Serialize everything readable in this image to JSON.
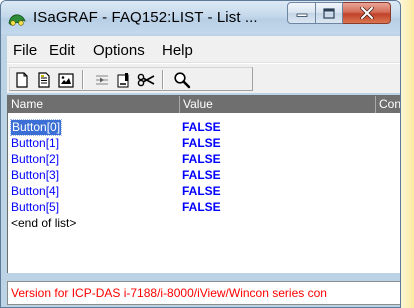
{
  "window": {
    "title": "ISaGRAF - FAQ152:LIST - List ..."
  },
  "menu": {
    "file": "File",
    "edit": "Edit",
    "options": "Options",
    "help": "Help"
  },
  "toolbar": {
    "icons": [
      "new-list-icon",
      "open-list-icon",
      "save-list-icon",
      "insert-variable-icon",
      "edit-variable-icon",
      "cut-icon",
      "search-icon"
    ]
  },
  "list": {
    "columns": [
      "Name",
      "Value",
      "Con"
    ],
    "rows": [
      {
        "name": "Button[0]",
        "value": "FALSE",
        "selected": true
      },
      {
        "name": "Button[1]",
        "value": "FALSE"
      },
      {
        "name": "Button[2]",
        "value": "FALSE"
      },
      {
        "name": "Button[3]",
        "value": "FALSE"
      },
      {
        "name": "Button[4]",
        "value": "FALSE"
      },
      {
        "name": "Button[5]",
        "value": "FALSE"
      }
    ],
    "end_label": "<end of list>"
  },
  "status": {
    "text": "Version for ICP-DAS i-7188/i-8000/iView/Wincon series con"
  },
  "colors": {
    "variable_text": "#0000ff",
    "header_bg": "#6f6f6f",
    "status_text": "#ff0000",
    "selection": "#3b6fd6"
  }
}
